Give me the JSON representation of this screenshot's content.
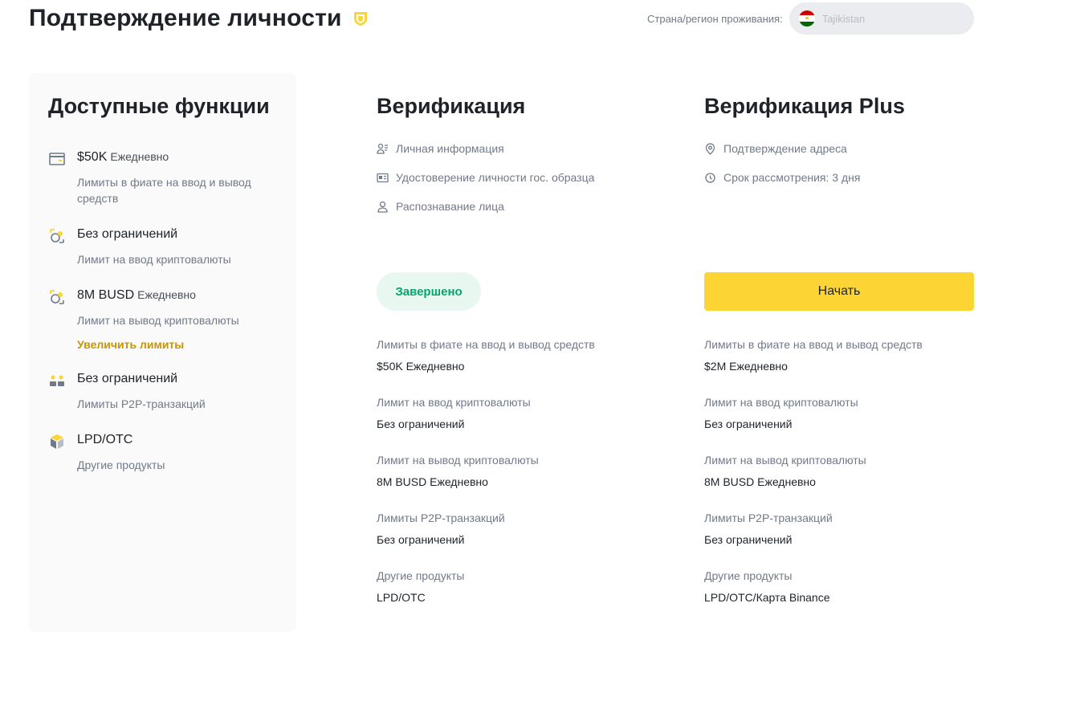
{
  "header": {
    "title": "Подтверждение личности",
    "country_label": "Страна/регион проживания:",
    "country_value": "Tajikistan"
  },
  "features": {
    "title": "Доступные функции",
    "items": [
      {
        "icon": "card-icon",
        "title": "$50K",
        "sub": "Ежедневно",
        "desc": "Лимиты в фиате на ввод и вывод средств"
      },
      {
        "icon": "crypto-deposit-icon",
        "title": "Без ограничений",
        "sub": "",
        "desc": "Лимит на ввод криптовалюты"
      },
      {
        "icon": "crypto-withdraw-icon",
        "title": "8M BUSD",
        "sub": "Ежедневно",
        "desc": "Лимит на вывод криптовалюты",
        "link": "Увеличить лимиты"
      },
      {
        "icon": "p2p-users-icon",
        "title": "Без ограничений",
        "sub": "",
        "desc": "Лимиты P2P-транзакций"
      },
      {
        "icon": "cube-icon",
        "title": "LPD/OTC",
        "sub": "",
        "desc": "Другие продукты"
      }
    ]
  },
  "verification": {
    "title": "Верификация",
    "requirements": [
      {
        "icon": "personal-info-icon",
        "label": "Личная информация"
      },
      {
        "icon": "id-card-icon",
        "label": "Удостоверение личности гос. образца"
      },
      {
        "icon": "face-icon",
        "label": "Распознавание лица"
      }
    ],
    "status": "Завершено",
    "limits": [
      {
        "label": "Лимиты в фиате на ввод и вывод средств",
        "value": "$50K Ежедневно"
      },
      {
        "label": "Лимит на ввод криптовалюты",
        "value": "Без ограничений"
      },
      {
        "label": "Лимит на вывод криптовалюты",
        "value": "8M BUSD Ежедневно"
      },
      {
        "label": "Лимиты P2P-транзакций",
        "value": "Без ограничений"
      },
      {
        "label": "Другие продукты",
        "value": "LPD/OTC"
      }
    ]
  },
  "verification_plus": {
    "title": "Верификация Plus",
    "requirements": [
      {
        "icon": "location-pin-icon",
        "label": "Подтверждение адреса"
      },
      {
        "icon": "clock-icon",
        "label": "Срок рассмотрения: 3 дня"
      }
    ],
    "button": "Начать",
    "limits": [
      {
        "label": "Лимиты в фиате на ввод и вывод средств",
        "value": "$2M Ежедневно"
      },
      {
        "label": "Лимит на ввод криптовалюты",
        "value": "Без ограничений"
      },
      {
        "label": "Лимит на вывод криптовалюты",
        "value": "8M BUSD Ежедневно"
      },
      {
        "label": "Лимиты P2P-транзакций",
        "value": "Без ограничений"
      },
      {
        "label": "Другие продукты",
        "value": "LPD/OTC/Карта Binance"
      }
    ]
  },
  "colors": {
    "accent_yellow": "#fcd535",
    "success_green": "#03a66d",
    "link_gold": "#c99400"
  }
}
